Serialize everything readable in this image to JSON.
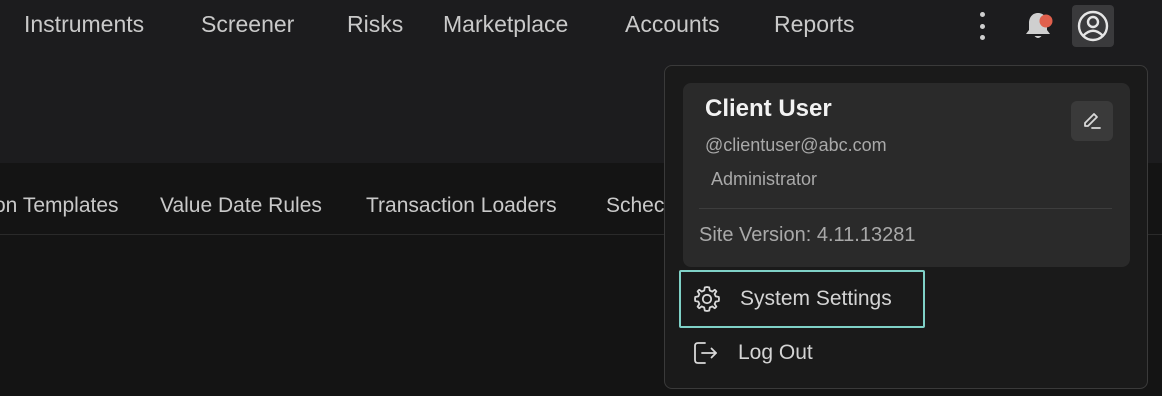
{
  "nav": {
    "items": [
      {
        "label": "Instruments"
      },
      {
        "label": "Screener"
      },
      {
        "label": "Risks"
      },
      {
        "label": "Marketplace"
      },
      {
        "label": "Accounts"
      },
      {
        "label": "Reports"
      }
    ]
  },
  "subtabs": {
    "items": [
      {
        "label": "on Templates"
      },
      {
        "label": "Value Date Rules"
      },
      {
        "label": "Transaction Loaders"
      },
      {
        "label": "Schec"
      }
    ]
  },
  "notifications": {
    "badge_color": "#e0604d"
  },
  "user_menu": {
    "name": "Client User",
    "email": "@clientuser@abc.com",
    "role": "Administrator",
    "site_version": "Site Version: 4.11.13281",
    "items": [
      {
        "label": "System Settings",
        "icon": "gear-icon",
        "selected": true
      },
      {
        "label": "Log Out",
        "icon": "logout-icon",
        "selected": false
      }
    ]
  },
  "colors": {
    "accent": "#7fd1c7",
    "background": "#141414",
    "topbar": "#1c1c1e"
  }
}
